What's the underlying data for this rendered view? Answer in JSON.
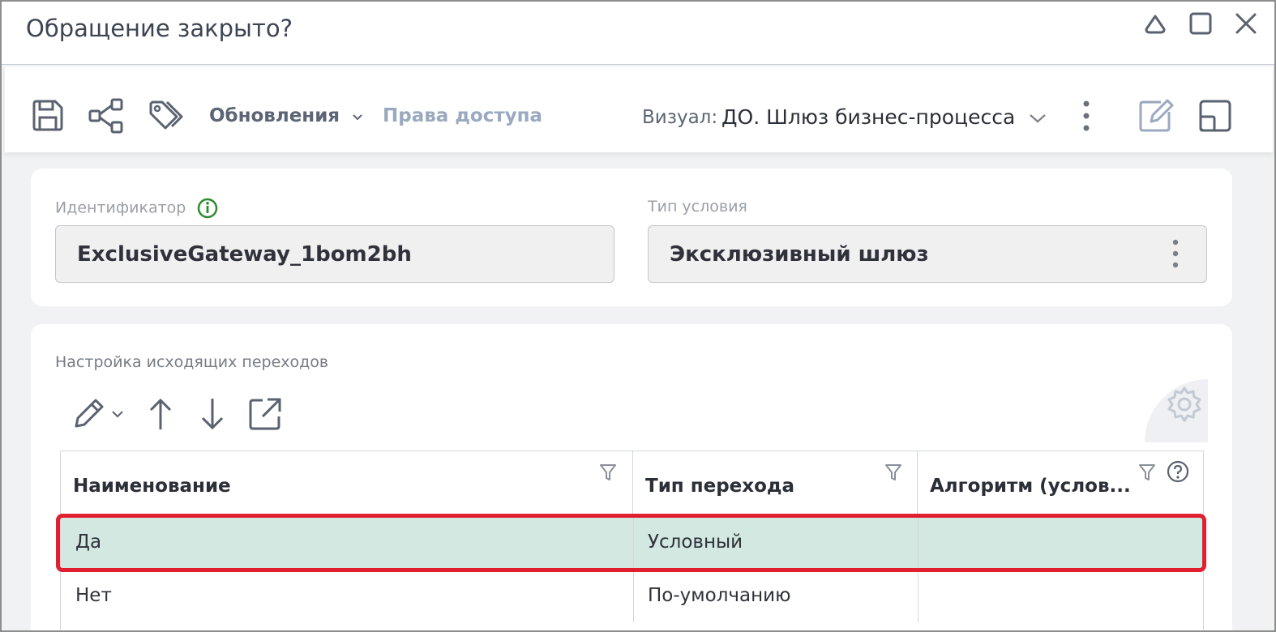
{
  "window": {
    "title": "Обращение закрыто?"
  },
  "toolbar": {
    "updates_label": "Обновления",
    "access_label": "Права доступа",
    "visual_label": "Визуал:",
    "visual_value": "ДО. Шлюз бизнес-процесса"
  },
  "form": {
    "identifier": {
      "label": "Идентификатор",
      "value": "ExclusiveGateway_1bom2bh"
    },
    "condition_type": {
      "label": "Тип условия",
      "value": "Эксклюзивный шлюз"
    }
  },
  "transitions": {
    "section_label": "Настройка исходящих переходов",
    "columns": [
      "Наименование",
      "Тип перехода",
      "Алгоритм (услов..."
    ],
    "rows": [
      {
        "name": "Да",
        "type": "Условный",
        "algorithm": "",
        "selected": true
      },
      {
        "name": "Нет",
        "type": "По-умолчанию",
        "algorithm": "",
        "selected": false
      }
    ]
  },
  "icons": {
    "info": "info-icon",
    "filter": "filter-icon",
    "help": "help-icon",
    "settings": "gear-icon"
  },
  "colors": {
    "selected_row": "#d2e8e0",
    "selection_outline": "#e0202e",
    "info_green": "#2e8b2e"
  }
}
